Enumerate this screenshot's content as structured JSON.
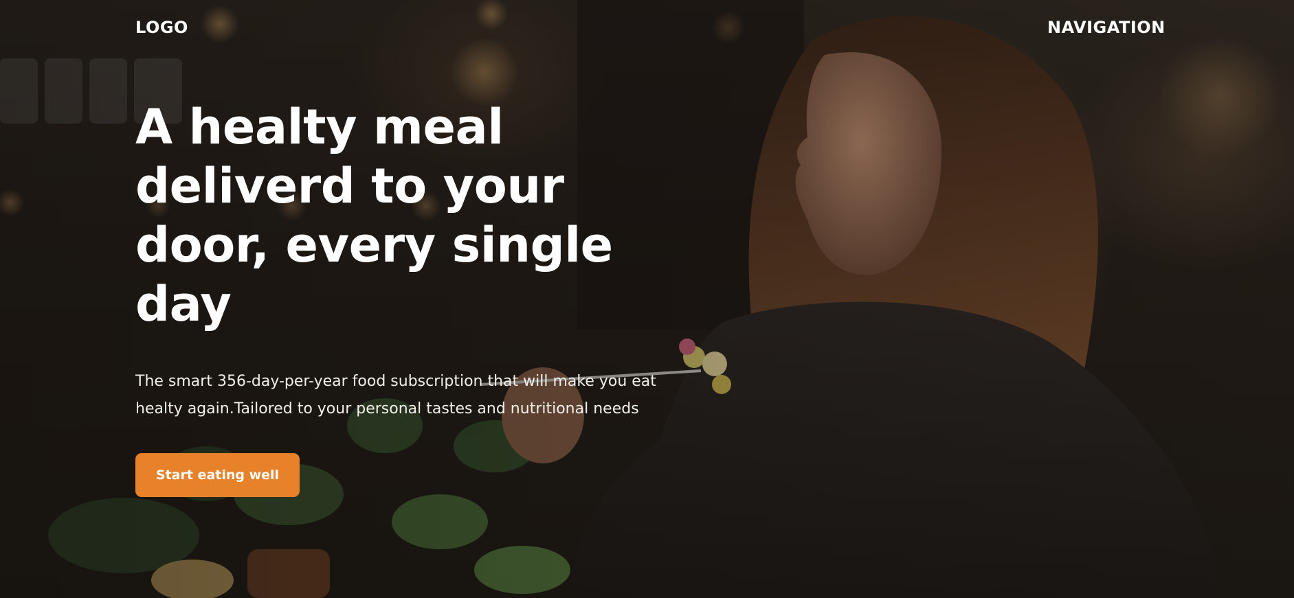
{
  "header": {
    "logo": "LOGO",
    "navigation": "NAVIGATION"
  },
  "hero": {
    "title": "A healty meal deliverd to your door, every single day",
    "subtitle": "The smart 356-day-per-year food subscription that will make you eat healty again.Tailored to your personal tastes and nutritional needs",
    "cta_label": "Start eating well"
  },
  "colors": {
    "accent": "#e8822a",
    "text": "#ffffff",
    "overlay": "#1a1613"
  }
}
